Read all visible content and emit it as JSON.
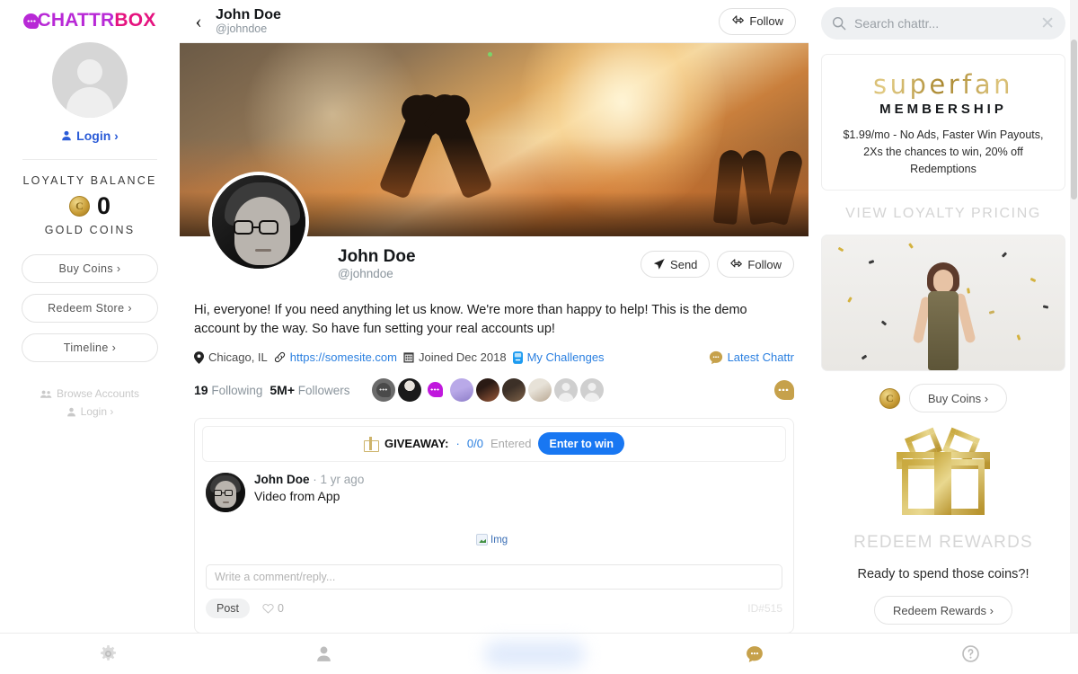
{
  "brand": {
    "part1": "CHATTR",
    "part2": "BOX",
    "bubble_icon": "chat-bubble-icon"
  },
  "left_sidebar": {
    "avatar_icon": "default-user-avatar",
    "login_label": "Login ›",
    "login_icon": "user-icon",
    "loyalty_title": "LOYALTY BALANCE",
    "coin_icon": "gold-coin-icon",
    "coin_count": "0",
    "gold_coins_label": "GOLD COINS",
    "buttons": [
      {
        "label": "Buy Coins ›",
        "name": "buy-coins-button"
      },
      {
        "label": "Redeem Store ›",
        "name": "redeem-store-button"
      },
      {
        "label": "Timeline ›",
        "name": "timeline-button"
      }
    ],
    "browse_accounts": "Browse Accounts",
    "browse_icon": "people-icon",
    "login_muted": "Login ›",
    "login_muted_icon": "user-icon"
  },
  "header": {
    "back_icon": "chevron-left-icon",
    "name": "John Doe",
    "handle": "@johndoe",
    "follow_label": "Follow",
    "follow_icon": "follow-arrow-icon"
  },
  "profile": {
    "cover_alt": "concert-crowd-heart-hands-cover",
    "avatar_alt": "john-doe-portrait",
    "name": "John Doe",
    "handle": "@johndoe",
    "send_label": "Send",
    "send_icon": "paper-plane-icon",
    "follow_label": "Follow",
    "follow_icon": "follow-arrow-icon",
    "bio": "Hi, everyone! If you need anything let us know. We're more than happy to help! This is the demo account by the way. So have fun setting your real accounts up!",
    "meta": {
      "location": "Chicago, IL",
      "location_icon": "map-pin-icon",
      "website": "https://somesite.com",
      "website_icon": "link-icon",
      "joined": "Joined Dec 2018",
      "joined_icon": "calendar-icon",
      "challenges": "My Challenges",
      "challenges_icon": "mobile-icon",
      "latest": "Latest Chattr",
      "latest_icon": "chattr-bubble-icon"
    },
    "stats": {
      "following_count": "19",
      "following_label": "Following",
      "followers_count": "5M+",
      "followers_label": "Followers"
    },
    "friend_avatars": [
      "avatar-chattr-dark",
      "avatar-person-bw",
      "avatar-chattr-purple",
      "avatar-person-purple-bg",
      "avatar-woman-red-hair",
      "avatar-man-beard",
      "avatar-woman-green-bg",
      "avatar-default-1",
      "avatar-default-2"
    ]
  },
  "post": {
    "giveaway_icon": "gift-icon",
    "giveaway_label": "GIVEAWAY:",
    "giveaway_sep": "·",
    "giveaway_count": "0/0",
    "giveaway_entered": "Entered",
    "enter_button": "Enter to win",
    "author": "John Doe",
    "author_sep": "·",
    "time": "1 yr ago",
    "text": "Video from App",
    "broken_image_label": "Img",
    "broken_image_icon": "broken-image-icon",
    "comment_placeholder": "Write a comment/reply...",
    "post_button": "Post",
    "like_icon": "heart-icon",
    "like_count": "0",
    "post_id": "ID#515"
  },
  "right_sidebar": {
    "search_icon": "search-icon",
    "search_placeholder": "Search chattr...",
    "search_clear_icon": "close-icon",
    "superfan_title": "superfan",
    "superfan_sub": "MEMBERSHIP",
    "superfan_desc": "$1.99/mo - No Ads, Faster Win Payouts, 2Xs the chances to win, 20% off Redemptions",
    "view_pricing": "VIEW LOYALTY PRICING",
    "promo_alt": "woman-with-gold-confetti",
    "buy_coin_icon": "gold-coin-icon",
    "buy_coins_label": "Buy Coins ›",
    "gift_icon": "gold-gift-box-icon",
    "redeem_title": "REDEEM REWARDS",
    "redeem_sub": "Ready to spend those coins?!",
    "redeem_button": "Redeem Rewards ›"
  },
  "bottom_nav": [
    {
      "name": "nav-settings",
      "icon": "gear-icon"
    },
    {
      "name": "nav-profile",
      "icon": "user-icon"
    },
    {
      "name": "nav-center-highlight",
      "icon": "blurred-pill"
    },
    {
      "name": "nav-coins",
      "icon": "chattr-coin-icon"
    },
    {
      "name": "nav-help",
      "icon": "question-circle-icon"
    }
  ],
  "colors": {
    "brand_purple": "#b829d6",
    "brand_pink": "#e5137f",
    "link_blue": "#2a7fe0",
    "button_blue": "#1877f2",
    "gold": "#c9a93f"
  }
}
